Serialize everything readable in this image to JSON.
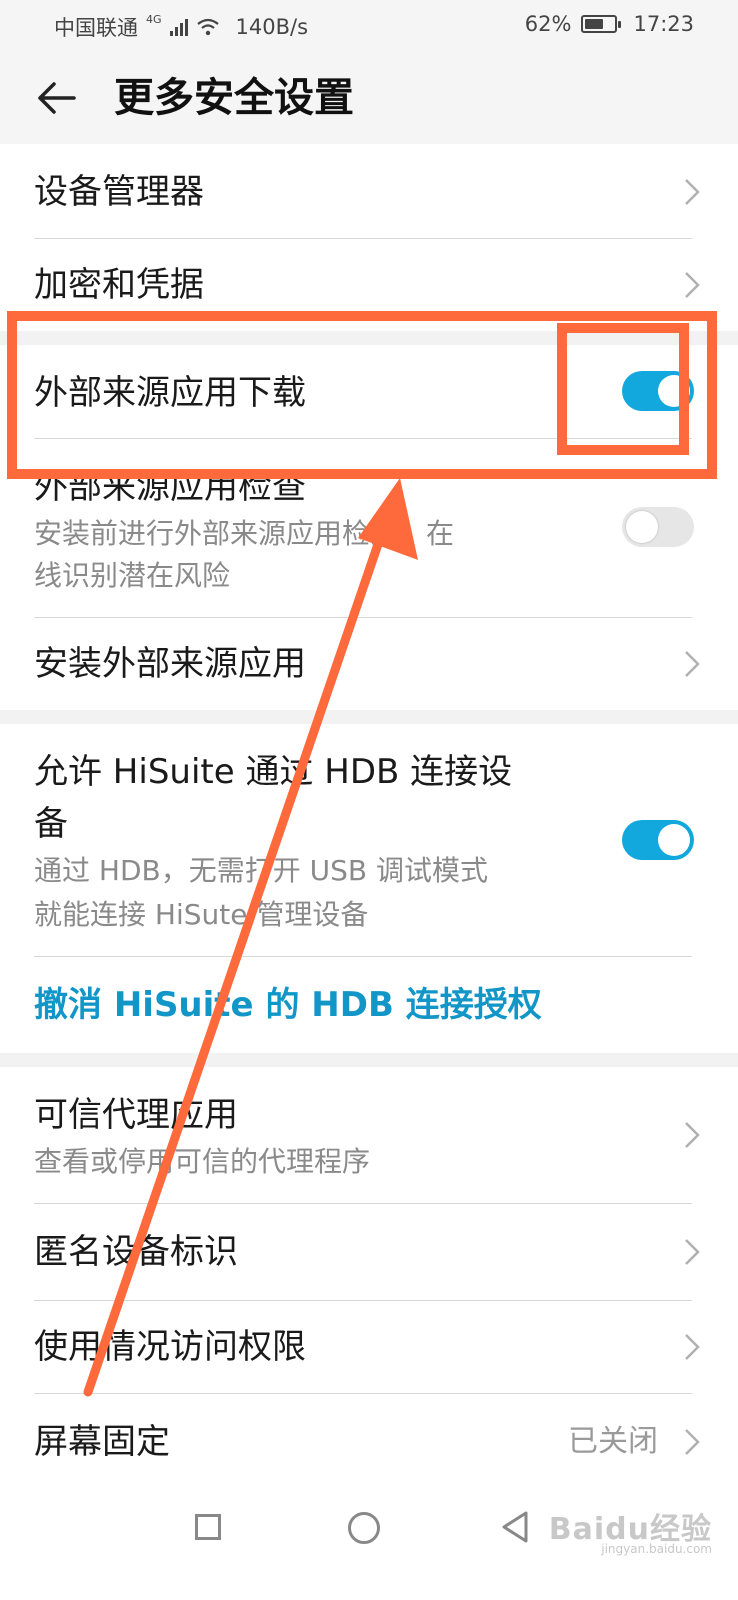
{
  "status_bar": {
    "carrier": "中国联通",
    "network": "4G",
    "speed": "140B/s",
    "battery": "62%",
    "battery_level": 0.62,
    "time": "17:23"
  },
  "header": {
    "title": "更多安全设置",
    "back_icon": "arrow-left-icon"
  },
  "items": {
    "device_admin": {
      "title": "设备管理器"
    },
    "encryption": {
      "title": "加密和凭据"
    },
    "external_download": {
      "title": "外部来源应用下载",
      "enabled": true
    },
    "external_check": {
      "title": "外部来源应用检查",
      "subtitle_line1": "安装前进行外部来源应用检查，在",
      "subtitle_line2": "线识别潜在风险",
      "enabled": false
    },
    "install_external": {
      "title": "安装外部来源应用"
    },
    "hisuite_hdb": {
      "title_line1": "允许 HiSuite 通过 HDB 连接设",
      "title_line2": "备",
      "subtitle_line1": "通过 HDB，无需打开 USB 调试模式",
      "subtitle_line2": "就能连接 HiSute 管理设备",
      "enabled": true
    },
    "revoke_hdb": {
      "title": "撤消 HiSuite 的 HDB 连接授权"
    },
    "trust_agents": {
      "title": "可信代理应用",
      "subtitle": "查看或停用可信的代理程序"
    },
    "anonymous_id": {
      "title": "匿名设备标识"
    },
    "usage_access": {
      "title": "使用情况访问权限"
    },
    "screen_pinning": {
      "title": "屏幕固定",
      "value": "已关闭"
    }
  },
  "watermark": {
    "text": "Baidu经验",
    "sub": "jingyan.baidu.com"
  },
  "colors": {
    "accent": "#12a8de",
    "link": "#1296c8",
    "annotation": "#ff6a3d"
  }
}
